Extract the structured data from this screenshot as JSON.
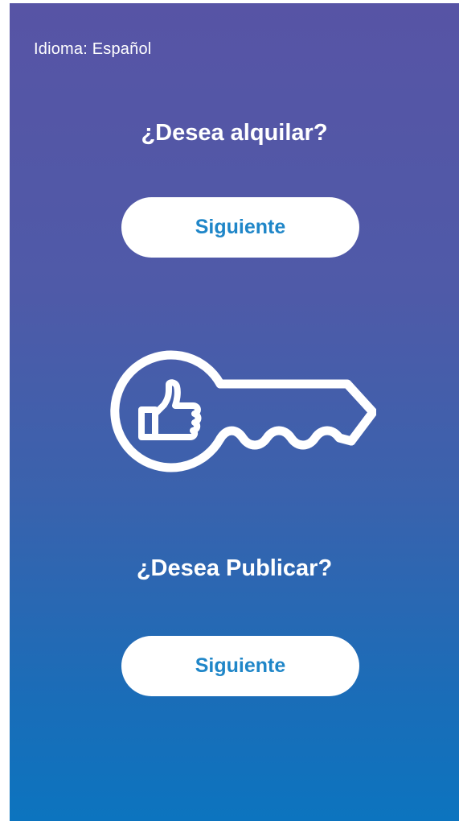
{
  "header": {
    "language_label": "Idioma: Español"
  },
  "rent": {
    "question": "¿Desea alquilar?",
    "button_label": "Siguiente"
  },
  "publish": {
    "question": "¿Desea Publicar?",
    "button_label": "Siguiente"
  },
  "icons": {
    "center": "key-with-thumbs-up-icon"
  },
  "colors": {
    "gradient_top": "#5754a5",
    "gradient_bottom": "#0c74bf",
    "button_bg": "#ffffff",
    "button_text": "#1f86c8",
    "text": "#ffffff"
  }
}
